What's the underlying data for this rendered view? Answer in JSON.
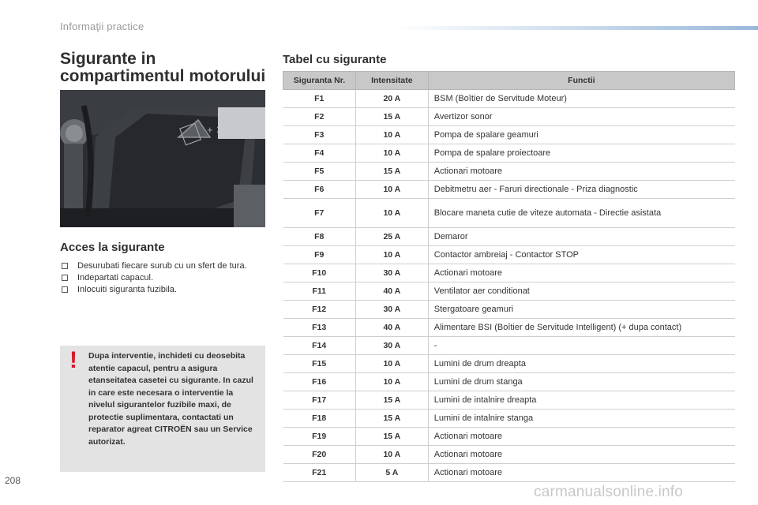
{
  "header": {
    "title": "Informaţii practice"
  },
  "left": {
    "title": "Sigurante in compartimentul motorului",
    "photo_label": "engine-compartment-photo",
    "access_title": "Acces la sigurante",
    "steps": [
      "Desurubati fiecare surub cu un sfert de tura.",
      "Indepartati capacul.",
      "Inlocuiti siguranta fuzibila."
    ],
    "warning_mark": "!",
    "warning": "Dupa interventie, inchideti cu deosebita atentie capacul, pentru a asigura etanseitatea casetei cu sigurante. In cazul in care este necesara o interventie la nivelul sigurantelor fuzibile maxi, de protectie suplimentara, contactati un reparator agreat CITROËN sau un Service autorizat."
  },
  "table": {
    "title": "Tabel cu sigurante",
    "headers": [
      "Siguranta Nr.",
      "Intensitate",
      "Functii"
    ],
    "rows": [
      {
        "nr": "F1",
        "amp": "20 A",
        "func": "BSM (Boîtier de Servitude Moteur)"
      },
      {
        "nr": "F2",
        "amp": "15 A",
        "func": "Avertizor sonor"
      },
      {
        "nr": "F3",
        "amp": "10 A",
        "func": "Pompa de spalare geamuri"
      },
      {
        "nr": "F4",
        "amp": "10 A",
        "func": "Pompa de spalare proiectoare"
      },
      {
        "nr": "F5",
        "amp": "15 A",
        "func": "Actionari motoare"
      },
      {
        "nr": "F6",
        "amp": "10 A",
        "func": "Debitmetru aer - Faruri directionale - Priza diagnostic"
      },
      {
        "nr": "F7",
        "amp": "10 A",
        "func": "Blocare maneta cutie de viteze automata - Directie asistata"
      },
      {
        "nr": "F8",
        "amp": "25 A",
        "func": "Demaror"
      },
      {
        "nr": "F9",
        "amp": "10 A",
        "func": "Contactor ambreiaj - Contactor STOP"
      },
      {
        "nr": "F10",
        "amp": "30 A",
        "func": "Actionari motoare"
      },
      {
        "nr": "F11",
        "amp": "40 A",
        "func": "Ventilator aer conditionat"
      },
      {
        "nr": "F12",
        "amp": "30 A",
        "func": "Stergatoare geamuri"
      },
      {
        "nr": "F13",
        "amp": "40 A",
        "func": "Alimentare BSI (Boîtier de Servitude Intelligent) (+ dupa contact)"
      },
      {
        "nr": "F14",
        "amp": "30 A",
        "func": "-"
      },
      {
        "nr": "F15",
        "amp": "10 A",
        "func": "Lumini de drum dreapta"
      },
      {
        "nr": "F16",
        "amp": "10 A",
        "func": "Lumini de drum stanga"
      },
      {
        "nr": "F17",
        "amp": "15 A",
        "func": "Lumini de intalnire dreapta"
      },
      {
        "nr": "F18",
        "amp": "15 A",
        "func": "Lumini de intalnire stanga"
      },
      {
        "nr": "F19",
        "amp": "15 A",
        "func": "Actionari motoare"
      },
      {
        "nr": "F20",
        "amp": "10 A",
        "func": "Actionari motoare"
      },
      {
        "nr": "F21",
        "amp": "5 A",
        "func": "Actionari motoare"
      }
    ]
  },
  "footer": {
    "page_number": "208",
    "watermark": "carmanualsonline.info"
  }
}
